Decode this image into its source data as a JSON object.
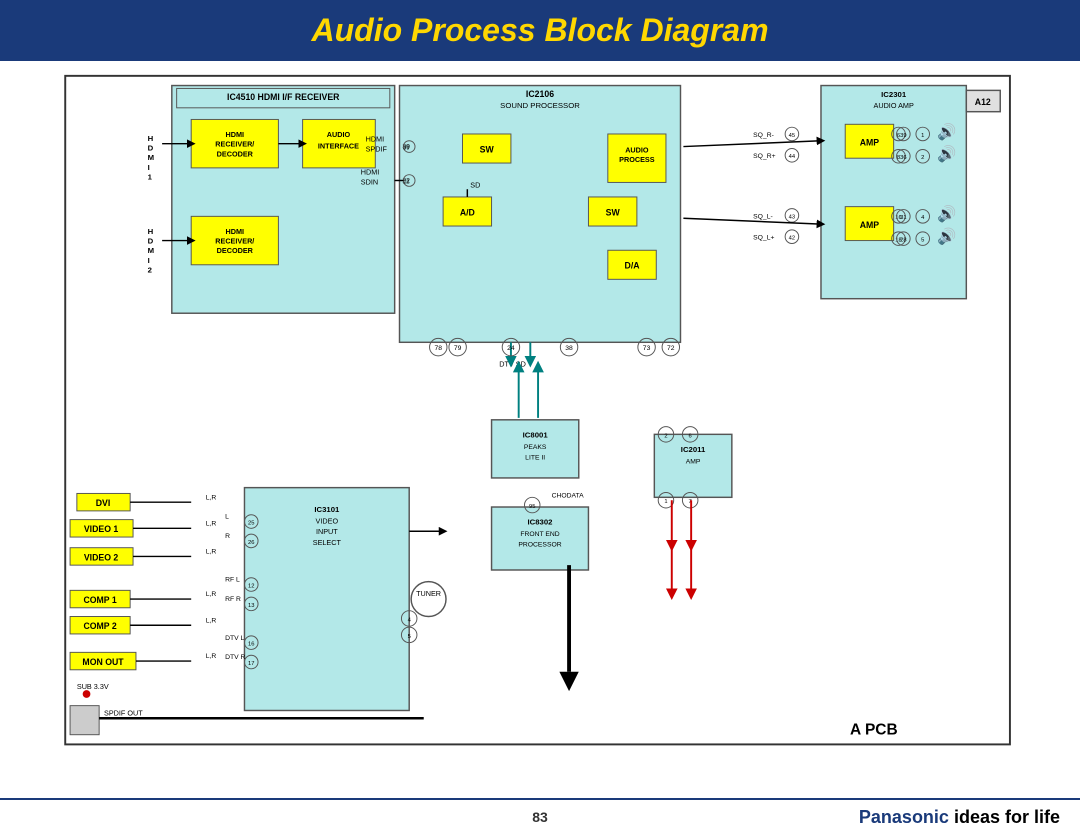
{
  "header": {
    "title": "Audio Process Block Diagram",
    "bg_color": "#1a3a7a",
    "title_color": "#ffd700"
  },
  "footer": {
    "page_number": "83",
    "brand_name": "Panasonic",
    "tagline": " ideas for life"
  },
  "diagram": {
    "title": "Audio Process Block Diagram",
    "components": {
      "ic4510": "IC4510 HDMI I/F RECEIVER",
      "ic2106": "IC2106 SOUND PROCESSOR",
      "ic2301": "IC2301 AUDIO AMP",
      "ic3101": "IC3101 VIDEO INPUT SELECT",
      "ic8001": "IC8001 PEAKS LITE II",
      "ic8302": "IC8302 FRONT END PROCESSOR",
      "ic2011": "IC2011 AMP",
      "a12": "A12",
      "apcb": "A PCB"
    },
    "inputs": [
      "DVI",
      "VIDEO 1",
      "VIDEO 2",
      "COMP 1",
      "COMP 2",
      "MON OUT"
    ],
    "signals": [
      "HDMI",
      "SPDIF",
      "HDMI SDIN",
      "SW",
      "SD",
      "A/D",
      "D/A",
      "DTV SD",
      "CHODATA",
      "RF L",
      "RF R",
      "DTV L",
      "DTV R",
      "TUNER",
      "SPDIF OUT",
      "SUB 3.3V"
    ]
  }
}
